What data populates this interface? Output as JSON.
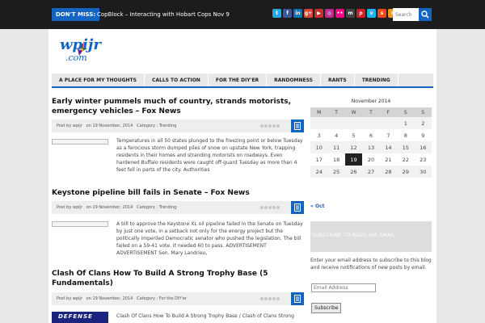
{
  "topbar": {
    "dont_miss_label": "DON'T MISS:",
    "ticker_text": "CopBlock – Interacting with Hobart Cops Nov 9",
    "search_placeholder": "Search",
    "social_icons": [
      {
        "name": "twitter-icon",
        "glyph": "t",
        "color": "#29a9e1"
      },
      {
        "name": "facebook-icon",
        "glyph": "f",
        "color": "#3b5998"
      },
      {
        "name": "linkedin-icon",
        "glyph": "in",
        "color": "#007bb5"
      },
      {
        "name": "google-plus-icon",
        "glyph": "g+",
        "color": "#d34836"
      },
      {
        "name": "youtube-icon",
        "glyph": "▶",
        "color": "#c4302b"
      },
      {
        "name": "instagram-icon",
        "glyph": "◎",
        "color": "#bc2a8d"
      },
      {
        "name": "flickr-icon",
        "glyph": "••",
        "color": "#ff0084"
      },
      {
        "name": "myspace-icon",
        "glyph": "m",
        "color": "#444444"
      },
      {
        "name": "pinterest-icon",
        "glyph": "p",
        "color": "#cb2027"
      },
      {
        "name": "vimeo-icon",
        "glyph": "v",
        "color": "#1ab7ea"
      },
      {
        "name": "stumbleupon-icon",
        "glyph": "s",
        "color": "#eb4924"
      },
      {
        "name": "rss-icon",
        "glyph": "r",
        "color": "#f29a1d"
      }
    ]
  },
  "logo": {
    "word": "wpijr",
    "domain": ".com"
  },
  "nav": {
    "items": [
      "A PLACE FOR MY THOUGHTS",
      "CALLS TO ACTION",
      "FOR THE DIY'ER",
      "RANDOMNESS",
      "RANTS",
      "TRENDING"
    ]
  },
  "posts": [
    {
      "title": "Early winter pummels much of country, strands motorists, emergency vehicles – Fox News",
      "author": "Post by wpijr",
      "date": "on 19 November, 2014",
      "category": "Category : Trending",
      "excerpt": "Temperatures in all 50 states plunged to the freezing point or below Tuesday as a ferocious storm dumped piles of snow on upstate New York, trapping residents in their homes and stranding motorists on roadways.  Even hardened Buffalo residents were caught off-guard Tuesday as more than 4 feet fell in parts of the city. Authorities"
    },
    {
      "title": "Keystone pipeline bill fails in Senate – Fox News",
      "author": "Post by wpijr",
      "date": "on 19 November, 2014",
      "category": "Category : Trending",
      "excerpt": "A bill to approve the Keystone XL oil pipeline failed in the Senate on Tuesday by just one vote, in a setback not only for the energy project but the politically imperiled Democratic senator who pushed the legislation.  The bill failed on a 59-41 vote. It needed 60 to pass. ADVERTISEMENT ADVERTISEMENT Sen. Mary Landrieu,"
    },
    {
      "title": "Clash Of Clans How To Build A Strong Trophy Base (5 Fundamentals)",
      "author": "Post by wpijr",
      "date": "on 19 November, 2014",
      "category": "Category : For the DIY'er",
      "excerpt": "Clash Of Clans How To Build A Strong Trophy Base / Clash of Clans Strong",
      "thumb_text": "DEFENSE"
    }
  ],
  "calendar": {
    "caption": "November 2014",
    "days": [
      "M",
      "T",
      "W",
      "T",
      "F",
      "S",
      "S"
    ],
    "weeks": [
      [
        "",
        "",
        "",
        "",
        "",
        "1",
        "2"
      ],
      [
        "3",
        "4",
        "5",
        "6",
        "7",
        "8",
        "9"
      ],
      [
        "10",
        "11",
        "12",
        "13",
        "14",
        "15",
        "16"
      ],
      [
        "17",
        "18",
        "19",
        "20",
        "21",
        "22",
        "23"
      ],
      [
        "24",
        "25",
        "26",
        "27",
        "28",
        "29",
        "30"
      ]
    ],
    "today": "19",
    "prev_link": "« Oct"
  },
  "subscribe": {
    "heading": "SUBSCRIBE TO BLOG VIA EMAIL",
    "text": "Enter your email address to subscribe to this blog and receive notifications of new posts by email.",
    "email_placeholder": "Email Address",
    "button_label": "Subscribe"
  },
  "colors": {
    "accent": "#1565c0",
    "topbar": "#1c1c1c"
  }
}
